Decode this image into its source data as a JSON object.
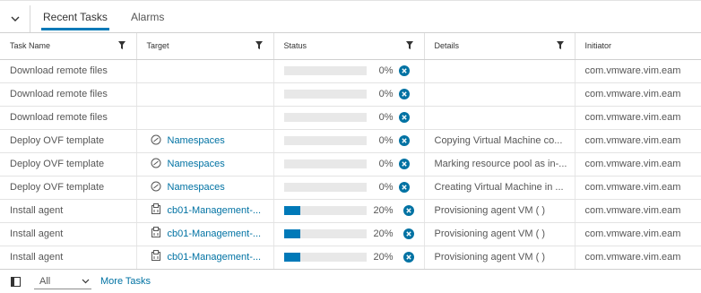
{
  "tabs": [
    {
      "label": "Recent Tasks",
      "active": true
    },
    {
      "label": "Alarms",
      "active": false
    }
  ],
  "columns": [
    "Task Name",
    "Target",
    "Status",
    "Details",
    "Initiator"
  ],
  "rows": [
    {
      "task": "Download remote files",
      "target": "",
      "progress": 0,
      "percent": "0%",
      "details": "",
      "initiator": "com.vmware.vim.eam"
    },
    {
      "task": "Download remote files",
      "target": "",
      "progress": 0,
      "percent": "0%",
      "details": "",
      "initiator": "com.vmware.vim.eam"
    },
    {
      "task": "Download remote files",
      "target": "",
      "progress": 0,
      "percent": "0%",
      "details": "",
      "initiator": "com.vmware.vim.eam"
    },
    {
      "task": "Deploy OVF template",
      "target": "Namespaces",
      "target_icon": "resource-pool-icon",
      "progress": 0,
      "percent": "0%",
      "details": "Copying Virtual Machine co...",
      "initiator": "com.vmware.vim.eam"
    },
    {
      "task": "Deploy OVF template",
      "target": "Namespaces",
      "target_icon": "resource-pool-icon",
      "progress": 0,
      "percent": "0%",
      "details": "Marking resource pool as in-...",
      "initiator": "com.vmware.vim.eam"
    },
    {
      "task": "Deploy OVF template",
      "target": "Namespaces",
      "target_icon": "resource-pool-icon",
      "progress": 0,
      "percent": "0%",
      "details": "Creating Virtual Machine in ...",
      "initiator": "com.vmware.vim.eam"
    },
    {
      "task": "Install agent",
      "target": "cb01-Management-...",
      "target_icon": "cluster-icon",
      "progress": 20,
      "percent": "20%",
      "details": "Provisioning agent VM ( )",
      "initiator": "com.vmware.vim.eam"
    },
    {
      "task": "Install agent",
      "target": "cb01-Management-...",
      "target_icon": "cluster-icon",
      "progress": 20,
      "percent": "20%",
      "details": "Provisioning agent VM ( )",
      "initiator": "com.vmware.vim.eam"
    },
    {
      "task": "Install agent",
      "target": "cb01-Management-...",
      "target_icon": "cluster-icon",
      "progress": 20,
      "percent": "20%",
      "details": "Provisioning agent VM ( )",
      "initiator": "com.vmware.vim.eam"
    }
  ],
  "footer": {
    "filter_value": "All",
    "more_tasks": "More Tasks"
  },
  "colors": {
    "accent": "#0079b8",
    "link": "#0072a3",
    "cancel_icon": "#0072a3"
  }
}
